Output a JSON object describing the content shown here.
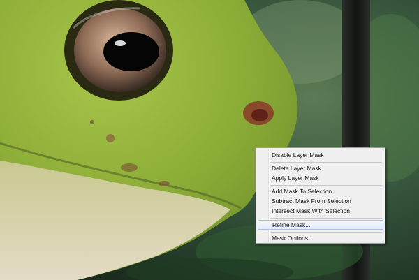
{
  "context_menu": {
    "items": [
      {
        "label": "Disable Layer Mask"
      },
      {
        "label": "Delete Layer Mask"
      },
      {
        "label": "Apply Layer Mask"
      },
      {
        "label": "Add Mask To Selection"
      },
      {
        "label": "Subtract Mask From Selection"
      },
      {
        "label": "Intersect Mask With Selection"
      },
      {
        "label": "Refine Mask..."
      },
      {
        "label": "Mask Options..."
      }
    ],
    "highlighted_item": "Refine Mask..."
  },
  "colors": {
    "frog_skin": "#8fb23a",
    "background_forest": "#2f4a33",
    "menu_background": "#f0f0f0",
    "highlight_border": "#a9c2e6"
  }
}
